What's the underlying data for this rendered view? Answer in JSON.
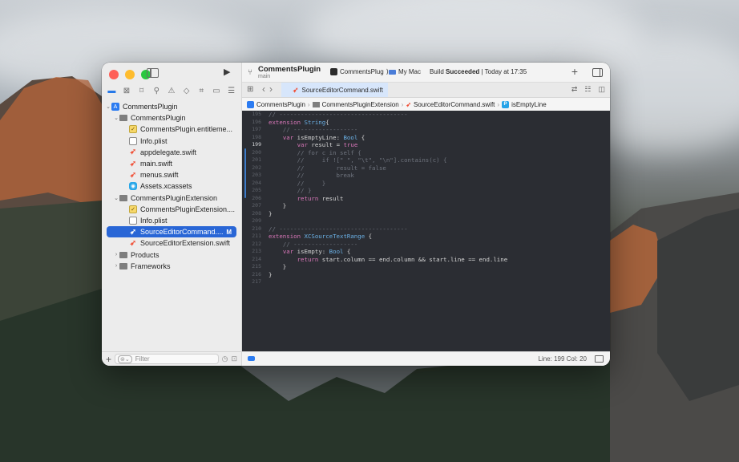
{
  "colors": {
    "accent": "#2966d6",
    "editor_bg": "#2b2d33",
    "swift": "#f05138"
  },
  "toolbar": {
    "project_title": "CommentsPlugin",
    "project_branch": "main",
    "scheme": "CommentsPlug",
    "scheme_chevron": "⟩",
    "destination": "My Mac",
    "status_prefix": "Build",
    "status_bold": "Succeeded",
    "status_suffix": "| Today at 17:35",
    "plus_label": "+"
  },
  "tab": {
    "label": "SourceEditorCommand.swift"
  },
  "breadcrumb": [
    "CommentsPlugin",
    "CommentsPluginExtension",
    "SourceEditorCommand.swift",
    "isEmptyLine"
  ],
  "navigator": {
    "filter_placeholder": "Filter",
    "items": [
      {
        "label": "CommentsPlugin",
        "icon": "project-icon"
      },
      {
        "label": "CommentsPlugin",
        "icon": "folder-icon"
      },
      {
        "label": "CommentsPlugin.entitleme...",
        "icon": "entitlements-icon"
      },
      {
        "label": "Info.plist",
        "icon": "plist-icon"
      },
      {
        "label": "appdelegate.swift",
        "icon": "swift-icon"
      },
      {
        "label": "main.swift",
        "icon": "swift-icon"
      },
      {
        "label": "menus.swift",
        "icon": "swift-icon"
      },
      {
        "label": "Assets.xcassets",
        "icon": "assets-icon"
      },
      {
        "label": "CommentsPluginExtension",
        "icon": "folder-icon"
      },
      {
        "label": "CommentsPluginExtension....",
        "icon": "entitlements-icon"
      },
      {
        "label": "Info.plist",
        "icon": "plist-icon"
      },
      {
        "label": "SourceEditorCommand....",
        "icon": "swift-icon",
        "badge": "M"
      },
      {
        "label": "SourceEditorExtension.swift",
        "icon": "swift-icon"
      },
      {
        "label": "Products",
        "icon": "folder-icon"
      },
      {
        "label": "Frameworks",
        "icon": "folder-icon"
      }
    ]
  },
  "editor": {
    "line_numbers": [
      "195",
      "196",
      "197",
      "198",
      "199",
      "200",
      "201",
      "202",
      "203",
      "204",
      "205",
      "206",
      "207",
      "208",
      "209",
      "210",
      "211",
      "212",
      "213",
      "214",
      "215",
      "216",
      "217"
    ],
    "current_line": "199"
  },
  "status_bar": {
    "position": "Line: 199  Col: 20"
  }
}
